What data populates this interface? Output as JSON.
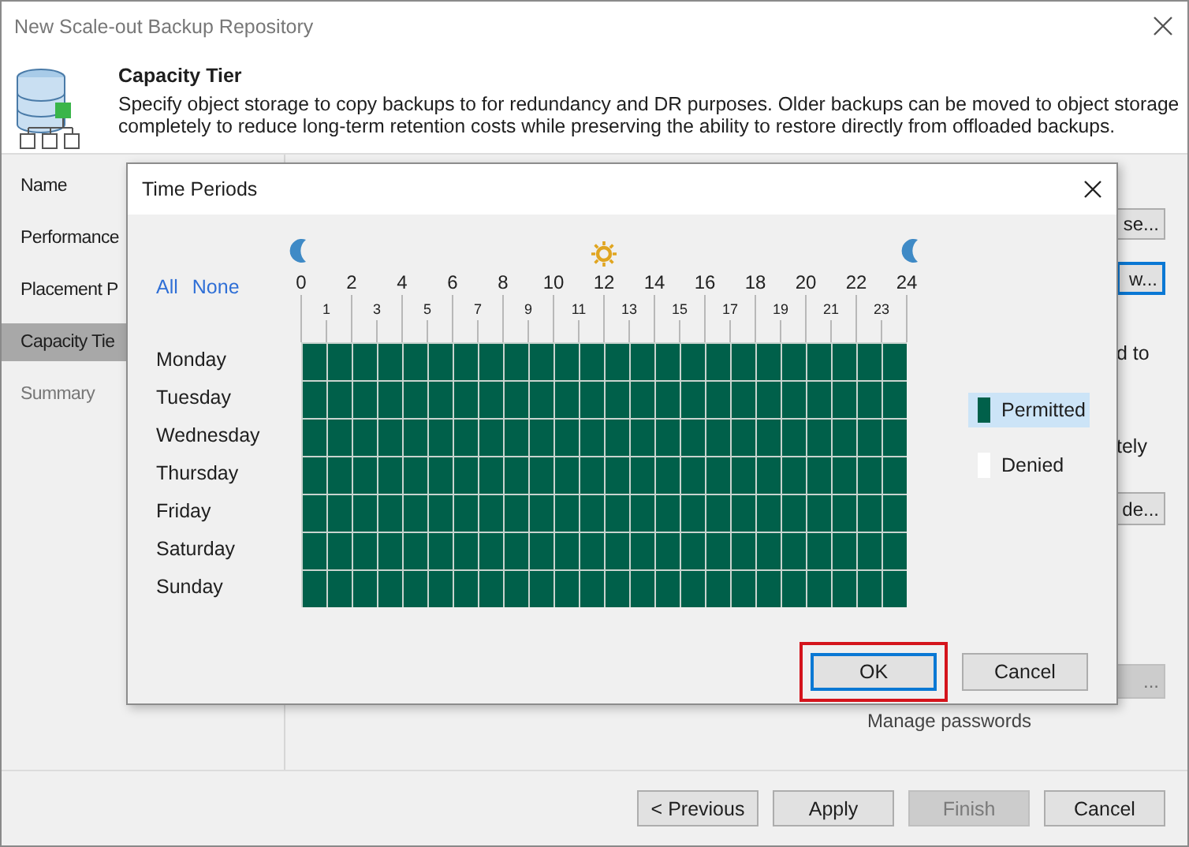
{
  "window": {
    "title": "New Scale-out Backup Repository"
  },
  "header": {
    "title": "Capacity Tier",
    "description": "Specify object storage to copy backups to for redundancy and DR purposes. Older backups can be moved to object storage completely to reduce long-term retention costs while preserving the ability to restore directly from offloaded backups."
  },
  "sidebar": {
    "items": [
      {
        "label": "Name",
        "selected": false,
        "disabled": false
      },
      {
        "label": "Performance",
        "selected": false,
        "disabled": false
      },
      {
        "label": "Placement P",
        "selected": false,
        "disabled": false
      },
      {
        "label": "Capacity Tie",
        "selected": true,
        "disabled": false
      },
      {
        "label": "Summary",
        "selected": false,
        "disabled": true
      }
    ]
  },
  "content": {
    "items": [
      {
        "kind": "button",
        "label": "se...",
        "focused": false,
        "disabled": false
      },
      {
        "kind": "button",
        "label": "w...",
        "focused": true,
        "disabled": false
      },
      {
        "kind": "text",
        "label": "d to"
      },
      {
        "kind": "text",
        "label": "tely"
      },
      {
        "kind": "button",
        "label": "de...",
        "focused": false,
        "disabled": false
      },
      {
        "kind": "button",
        "label": "...",
        "focused": false,
        "disabled": true
      }
    ],
    "manage_passwords": "Manage passwords"
  },
  "footer": {
    "buttons": [
      {
        "label": "< Previous",
        "disabled": false
      },
      {
        "label": "Apply",
        "disabled": false
      },
      {
        "label": "Finish",
        "disabled": true
      },
      {
        "label": "Cancel",
        "disabled": false
      }
    ]
  },
  "dialog": {
    "title": "Time Periods",
    "links": [
      "All",
      "None"
    ],
    "hours_major": [
      "0",
      "2",
      "4",
      "6",
      "8",
      "10",
      "12",
      "14",
      "16",
      "18",
      "20",
      "22",
      "24"
    ],
    "hours_minor": [
      "1",
      "3",
      "5",
      "7",
      "9",
      "11",
      "13",
      "15",
      "17",
      "19",
      "21",
      "23"
    ],
    "days": [
      {
        "name": "Monday",
        "permitted": [
          true,
          true,
          true,
          true,
          true,
          true,
          true,
          true,
          true,
          true,
          true,
          true,
          true,
          true,
          true,
          true,
          true,
          true,
          true,
          true,
          true,
          true,
          true,
          true
        ]
      },
      {
        "name": "Tuesday",
        "permitted": [
          true,
          true,
          true,
          true,
          true,
          true,
          true,
          true,
          true,
          true,
          true,
          true,
          true,
          true,
          true,
          true,
          true,
          true,
          true,
          true,
          true,
          true,
          true,
          true
        ]
      },
      {
        "name": "Wednesday",
        "permitted": [
          true,
          true,
          true,
          true,
          true,
          true,
          true,
          true,
          true,
          true,
          true,
          true,
          true,
          true,
          true,
          true,
          true,
          true,
          true,
          true,
          true,
          true,
          true,
          true
        ]
      },
      {
        "name": "Thursday",
        "permitted": [
          true,
          true,
          true,
          true,
          true,
          true,
          true,
          true,
          true,
          true,
          true,
          true,
          true,
          true,
          true,
          true,
          true,
          true,
          true,
          true,
          true,
          true,
          true,
          true
        ]
      },
      {
        "name": "Friday",
        "permitted": [
          true,
          true,
          true,
          true,
          true,
          true,
          true,
          true,
          true,
          true,
          true,
          true,
          true,
          true,
          true,
          true,
          true,
          true,
          true,
          true,
          true,
          true,
          true,
          true
        ]
      },
      {
        "name": "Saturday",
        "permitted": [
          true,
          true,
          true,
          true,
          true,
          true,
          true,
          true,
          true,
          true,
          true,
          true,
          true,
          true,
          true,
          true,
          true,
          true,
          true,
          true,
          true,
          true,
          true,
          true
        ]
      },
      {
        "name": "Sunday",
        "permitted": [
          true,
          true,
          true,
          true,
          true,
          true,
          true,
          true,
          true,
          true,
          true,
          true,
          true,
          true,
          true,
          true,
          true,
          true,
          true,
          true,
          true,
          true,
          true,
          true
        ]
      }
    ],
    "legend": [
      {
        "kind": "permitted",
        "label": "Permitted",
        "selected": true
      },
      {
        "kind": "denied",
        "label": "Denied",
        "selected": false
      }
    ],
    "buttons": [
      {
        "label": "OK",
        "focused": true,
        "highlighted": true
      },
      {
        "label": "Cancel",
        "focused": false,
        "highlighted": false
      }
    ]
  }
}
